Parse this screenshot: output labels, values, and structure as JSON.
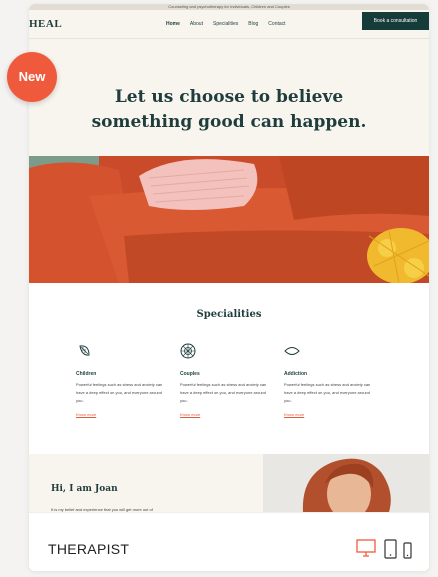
{
  "preview": {
    "top_strip": "Counseling and psychotherapy for Individuals, Children and Couples",
    "logo": "HEAL",
    "nav": [
      "Home",
      "About",
      "Specialities",
      "Blog",
      "Contact"
    ],
    "cta": "Book a consultation",
    "hero_line1": "Let us choose to believe",
    "hero_line2": "something good can happen.",
    "specialities": {
      "title": "Specialities",
      "items": [
        {
          "title": "Children",
          "desc": "Powerful feelings such as stress and anxiety can have a deep effect on you, and everyone around you.",
          "link": "Know more"
        },
        {
          "title": "Couples",
          "desc": "Powerful feelings such as stress and anxiety can have a deep effect on you, and everyone around you.",
          "link": "Know more"
        },
        {
          "title": "Addiction",
          "desc": "Powerful feelings such as stress and anxiety can have a deep effect on you, and everyone around you.",
          "link": "Know more"
        }
      ]
    },
    "about_title": "Hi, I am Joan",
    "about_text": "It is my belief and experience that you will get more out of"
  },
  "badge": "New",
  "card": {
    "title": "THERAPIST",
    "devices": [
      "desktop-icon",
      "tablet-icon",
      "mobile-icon"
    ]
  },
  "colors": {
    "accent": "#f05a3c",
    "dark_green": "#163c3a",
    "cream": "#f8f5ee",
    "sofa": "#d4532e"
  }
}
